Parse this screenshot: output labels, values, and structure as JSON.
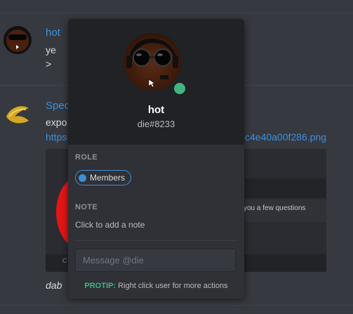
{
  "messages": [
    {
      "author": "hot",
      "lines": [
        "ye",
        ">"
      ]
    },
    {
      "author": "Spec",
      "text": "expo",
      "link_start": "https",
      "link_end": "c4e40a00f286.png",
      "caption": "dab"
    }
  ],
  "embed": {
    "text": "you a few questions",
    "corner": "C"
  },
  "popout": {
    "username": "hot",
    "tag": "die#8233",
    "status_color": "#43b581",
    "role_label": "ROLE",
    "role": {
      "name": "Members",
      "color": "#3d8fd6"
    },
    "note_label": "NOTE",
    "note_placeholder": "Click to add a note",
    "message_placeholder": "Message @die",
    "protip_label": "PROTIP:",
    "protip_text": "Right click user for more actions"
  }
}
